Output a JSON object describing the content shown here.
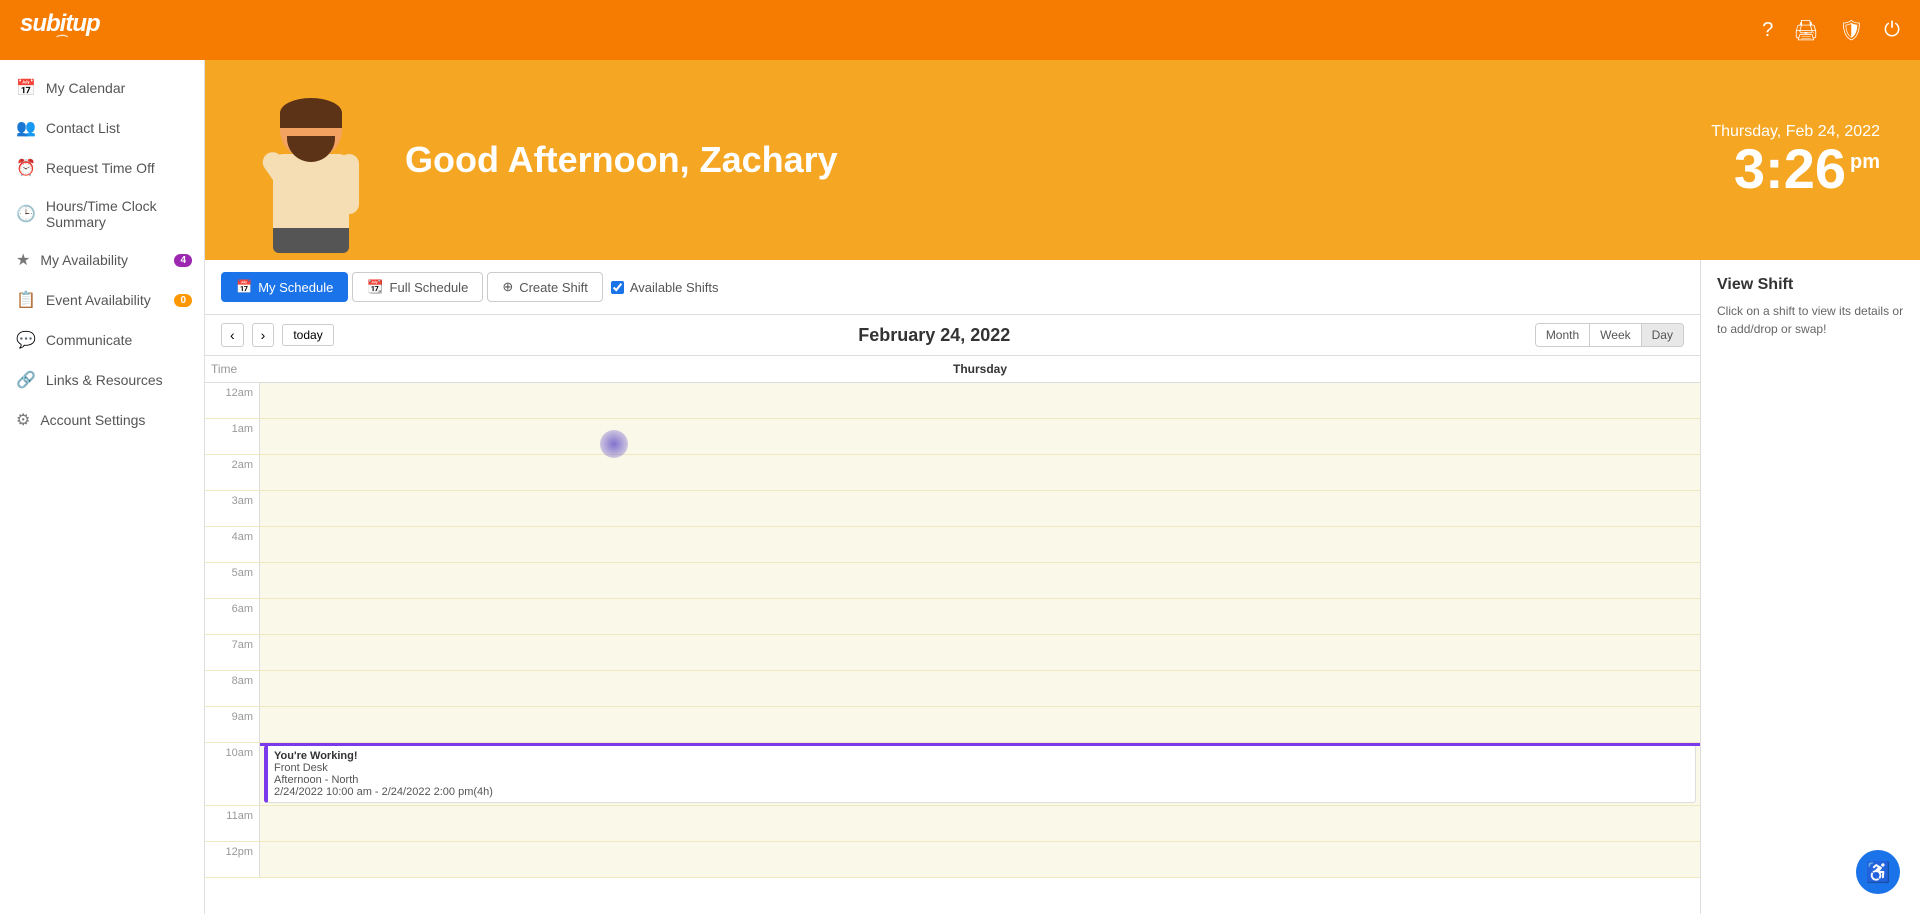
{
  "topbar": {
    "logo": "subitup",
    "logo_sub": "~",
    "icons": [
      "help-icon",
      "print-icon",
      "settings-icon",
      "power-icon"
    ]
  },
  "sidebar": {
    "items": [
      {
        "id": "my-calendar",
        "label": "My Calendar",
        "icon": "calendar-icon",
        "badge": null
      },
      {
        "id": "contact-list",
        "label": "Contact List",
        "icon": "contacts-icon",
        "badge": null
      },
      {
        "id": "request-time-off",
        "label": "Request Time Off",
        "icon": "request-icon",
        "badge": null
      },
      {
        "id": "hours-time-clock",
        "label": "Hours/Time Clock Summary",
        "icon": "clock-icon",
        "badge": null
      },
      {
        "id": "my-availability",
        "label": "My Availability",
        "icon": "star-icon",
        "badge": "4"
      },
      {
        "id": "event-availability",
        "label": "Event Availability",
        "icon": "event-icon",
        "badge": "0"
      },
      {
        "id": "communicate",
        "label": "Communicate",
        "icon": "communicate-icon",
        "badge": null
      },
      {
        "id": "links-resources",
        "label": "Links & Resources",
        "icon": "links-icon",
        "badge": null
      },
      {
        "id": "account-settings",
        "label": "Account Settings",
        "icon": "settings-icon",
        "badge": null
      }
    ]
  },
  "header": {
    "greeting": "Good Afternoon, Zachary",
    "date": "Thursday, Feb 24, 2022",
    "time": "3:26",
    "time_ampm": "pm"
  },
  "schedule": {
    "tabs": [
      {
        "id": "my-schedule",
        "label": "My Schedule",
        "active": true
      },
      {
        "id": "full-schedule",
        "label": "Full Schedule",
        "active": false
      },
      {
        "id": "create-shift",
        "label": "Create Shift",
        "active": false
      }
    ],
    "available_shifts_label": "Available Shifts",
    "available_shifts_checked": true,
    "current_date": "February 24, 2022",
    "day_label": "Thursday",
    "view_options": [
      "Month",
      "Week",
      "Day"
    ],
    "active_view": "Day",
    "time_rows": [
      {
        "label": "12am"
      },
      {
        "label": "1am"
      },
      {
        "label": "2am"
      },
      {
        "label": "3am"
      },
      {
        "label": "4am"
      },
      {
        "label": "5am"
      },
      {
        "label": "6am"
      },
      {
        "label": "7am"
      },
      {
        "label": "8am"
      },
      {
        "label": "9am"
      },
      {
        "label": "10am"
      },
      {
        "label": "11am"
      },
      {
        "label": "12pm"
      }
    ],
    "shift": {
      "title": "You're Working!",
      "location": "Front Desk",
      "area": "Afternoon - North",
      "time": "2/24/2022 10:00 am - 2/24/2022 2:00 pm(4h)"
    }
  },
  "view_shift_panel": {
    "title": "View Shift",
    "description": "Click on a shift to view its details or to add/drop or swap!"
  }
}
